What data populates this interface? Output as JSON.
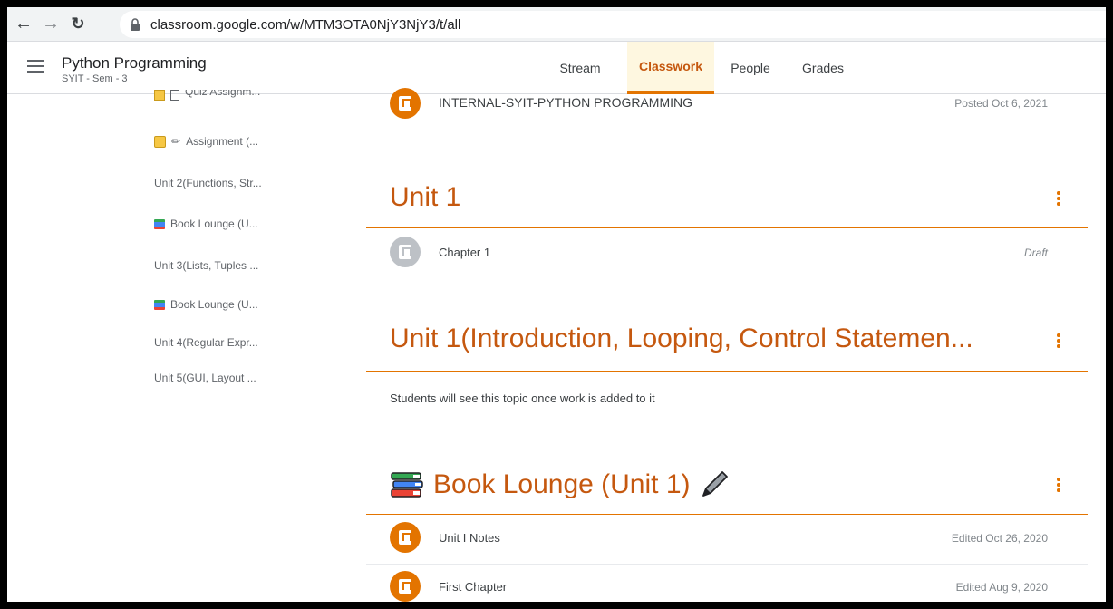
{
  "browser": {
    "url": "classroom.google.com/w/MTM3OTA0NjY3NjY3/t/all"
  },
  "header": {
    "class_name": "Python Programming",
    "class_section": "SYIT - Sem - 3",
    "tabs": [
      {
        "label": "Stream"
      },
      {
        "label": "Classwork"
      },
      {
        "label": "People"
      },
      {
        "label": "Grades"
      }
    ],
    "active_tab": "Classwork"
  },
  "sidebar": {
    "items": [
      {
        "label": "Quiz Assignm..."
      },
      {
        "label": "Assignment (..."
      },
      {
        "label": "Unit 2(Functions, Str..."
      },
      {
        "label": "Book Lounge (U..."
      },
      {
        "label": "Unit 3(Lists, Tuples ..."
      },
      {
        "label": "Book Lounge (U..."
      },
      {
        "label": "Unit 4(Regular Expr..."
      },
      {
        "label": "Unit 5(GUI, Layout ..."
      }
    ]
  },
  "main": {
    "top_item": {
      "title": "INTERNAL-SYIT-PYTHON PROGRAMMING",
      "meta": "Posted Oct 6, 2021"
    },
    "topics": [
      {
        "title": "Unit 1",
        "items": [
          {
            "title": "Chapter 1",
            "meta": "Draft"
          }
        ]
      },
      {
        "title": "Unit 1(Introduction, Looping, Control Statemen...",
        "empty_note": "Students will see this topic once work is added to it"
      },
      {
        "title": "Book Lounge (Unit 1)",
        "items": [
          {
            "title": "Unit I Notes",
            "meta": "Edited Oct 26, 2020"
          },
          {
            "title": "First Chapter",
            "meta": "Edited Aug 9, 2020"
          }
        ]
      }
    ]
  },
  "colors": {
    "accent": "#e37400",
    "accent_text": "#c5580f",
    "active_tab_bg": "#fef7e0"
  }
}
